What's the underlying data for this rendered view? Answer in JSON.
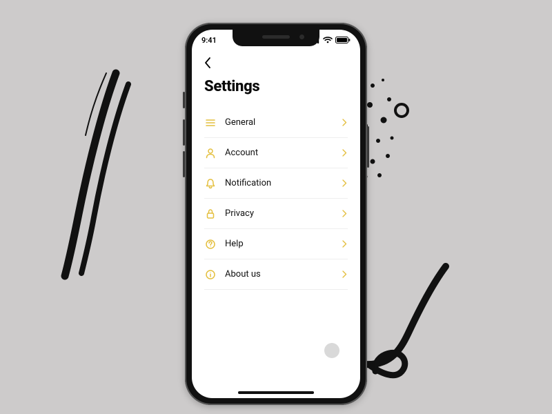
{
  "status": {
    "time": "9:41"
  },
  "page": {
    "title": "Settings"
  },
  "settings": {
    "items": [
      {
        "label": "General"
      },
      {
        "label": "Account"
      },
      {
        "label": "Notification"
      },
      {
        "label": "Privacy"
      },
      {
        "label": "Help"
      },
      {
        "label": "About us"
      }
    ]
  },
  "colors": {
    "accent": "#e4bf3e"
  }
}
